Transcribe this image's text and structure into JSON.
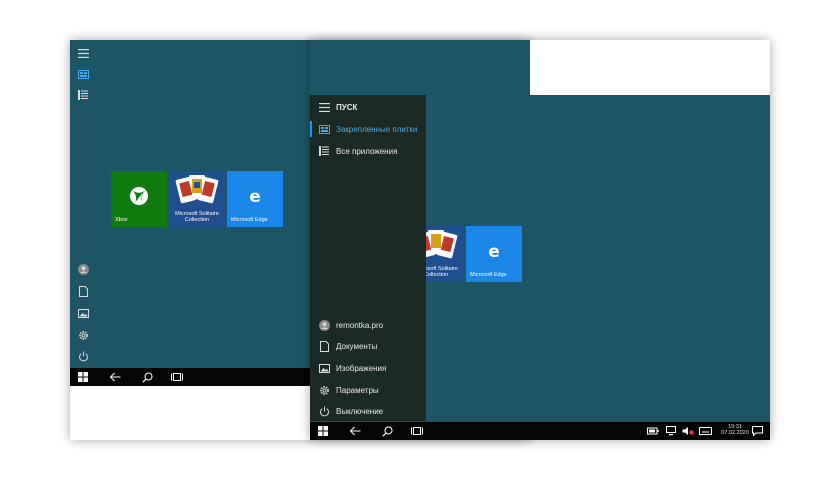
{
  "start_menu": {
    "title": "ПУСК",
    "pinned_label": "Закрепленные плитки",
    "all_apps_label": "Все приложения",
    "user_label": "remontka.pro",
    "documents_label": "Документы",
    "images_label": "Изображения",
    "settings_label": "Параметры",
    "power_label": "Выключение"
  },
  "tiles": {
    "xbox_label": "Xbox",
    "solitaire_label": "Microsoft Solitaire Collection",
    "edge_label": "Microsoft Edge"
  },
  "tray": {
    "time": "19:31",
    "date": "07.02.2020"
  },
  "colors": {
    "desktop": "#1e5566",
    "start_panel": "#1b2a24",
    "accent": "#1e90ff",
    "xbox_tile": "#107c10",
    "edge_tile": "#1a86e8"
  }
}
